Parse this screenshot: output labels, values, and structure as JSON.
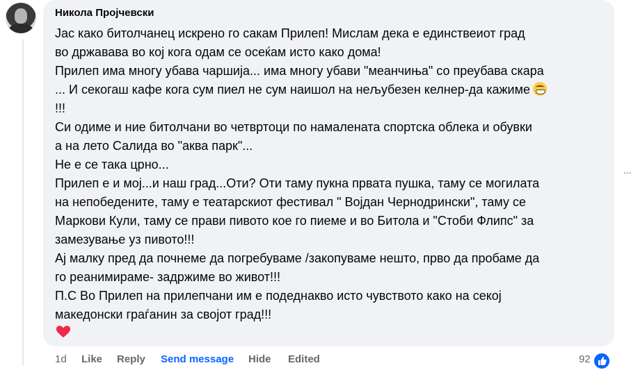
{
  "comment": {
    "author": "Никола Пројчевски",
    "lines": [
      "Јас како битолчанец искрено го сакам Прилеп! Мислам дека е единствеиот град",
      "во државава во кој кога одам се осеќам исто како дома!",
      "Прилеп има многу убава чаршија... има многу убави \"меанчиња\" со преубава скара",
      "... И секогаш кафе кога сум пиел не сум наишол на нељубезен келнер-да кажиме",
      "!!!",
      "Си одиме и ние битолчани во четвртоци по намалената спортска облека и обувки",
      "а на лето Салида во \"аква парк\"...",
      "Не е се така црно...",
      "Прилеп е и мој...и наш град...Оти? Оти таму пукна првата пушка, таму се могилата",
      "на непобедените, таму е театарскиот фестивал \" Војдан Чернодрински\", таму се",
      "Маркови Кули, таму се прави пивото кое го пиеме и во Битола и \"Стоби Флипс\" за",
      "замезување уз пивото!!!",
      "Ај малку пред да почнеме да погребуваме /закопуваме нешто, прво да пробаме да",
      "го реанимираме- задржиме во живот!!!",
      "П.С Во Прилеп на прилепчани им е подеднакво исто чувството како на секој",
      "македонски граѓанин за својот град!!!"
    ],
    "inline_emoji": "grinning-face-with-smiling-eyes-icon",
    "trailing_emoji": "red-heart-icon"
  },
  "actions": {
    "time": "1d",
    "like": "Like",
    "reply": "Reply",
    "send_message": "Send message",
    "hide": "Hide",
    "edited": "Edited"
  },
  "reactions": {
    "count": "92",
    "icon": "thumbs-up-icon"
  },
  "more_options": "···",
  "colors": {
    "bubble_bg": "#f0f2f5",
    "secondary_text": "#65676b",
    "accent_blue": "#0866ff",
    "heart_red": "#f02849"
  }
}
